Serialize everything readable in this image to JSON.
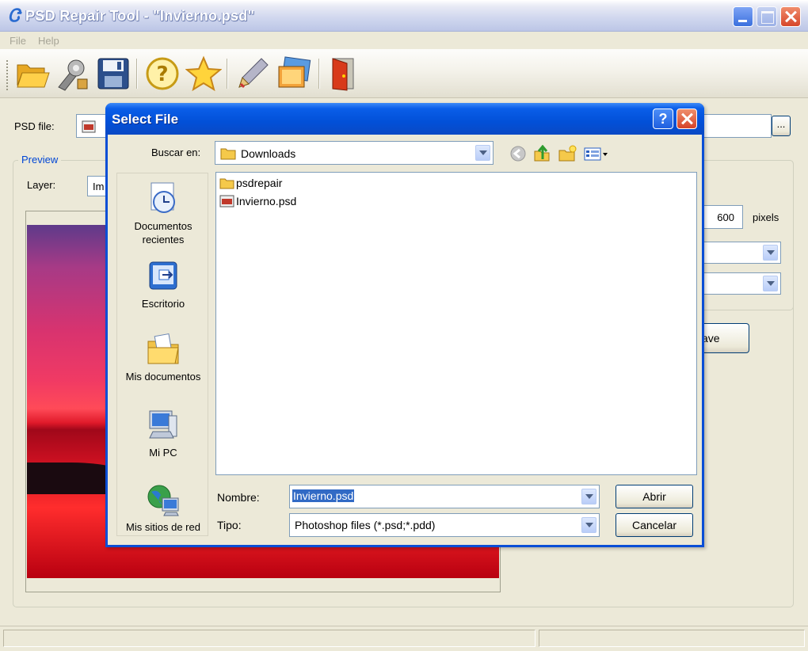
{
  "window": {
    "title": "PSD Repair Tool - \"Invierno.psd\"",
    "app_icon": "app-logo-icon"
  },
  "menu": {
    "items": [
      "File",
      "Help"
    ]
  },
  "toolbar": {
    "buttons": [
      "open-folder-icon",
      "repair-tool-icon",
      "save-disk-icon",
      "help-icon",
      "favorite-star-icon",
      "edit-pen-icon",
      "images-icon",
      "exit-door-icon"
    ]
  },
  "main": {
    "psd_file_label": "PSD file:",
    "browse_label": "...",
    "preview_caption": "Preview",
    "layer_label": "Layer:",
    "layer_value_partial": "Im",
    "width_value": "600",
    "pixels_label": "pixels",
    "save_partial": "ave"
  },
  "dialog": {
    "title": "Select File",
    "look_in_label": "Buscar en:",
    "look_in_value": "Downloads",
    "places": [
      {
        "label_line1": "Documentos",
        "label_line2": "recientes",
        "icon": "recent-documents-icon"
      },
      {
        "label_line1": "Escritorio",
        "label_line2": "",
        "icon": "desktop-icon"
      },
      {
        "label_line1": "Mis documentos",
        "label_line2": "",
        "icon": "my-documents-icon"
      },
      {
        "label_line1": "Mi PC",
        "label_line2": "",
        "icon": "my-computer-icon"
      },
      {
        "label_line1": "Mis sitios de red",
        "label_line2": "",
        "icon": "network-places-icon"
      }
    ],
    "files": [
      {
        "name": "psdrepair",
        "type": "folder"
      },
      {
        "name": "Invierno.psd",
        "type": "psd"
      }
    ],
    "name_label": "Nombre:",
    "name_value": "Invierno.psd",
    "type_label": "Tipo:",
    "type_value": "Photoshop files (*.psd;*.pdd)",
    "open_button": "Abrir",
    "cancel_button": "Cancelar"
  },
  "colors": {
    "xp_blue": "#0a4ed6",
    "title_gradient_top": "#3d8af7",
    "face": "#ece9d8",
    "border_blue": "#7f9db9"
  }
}
